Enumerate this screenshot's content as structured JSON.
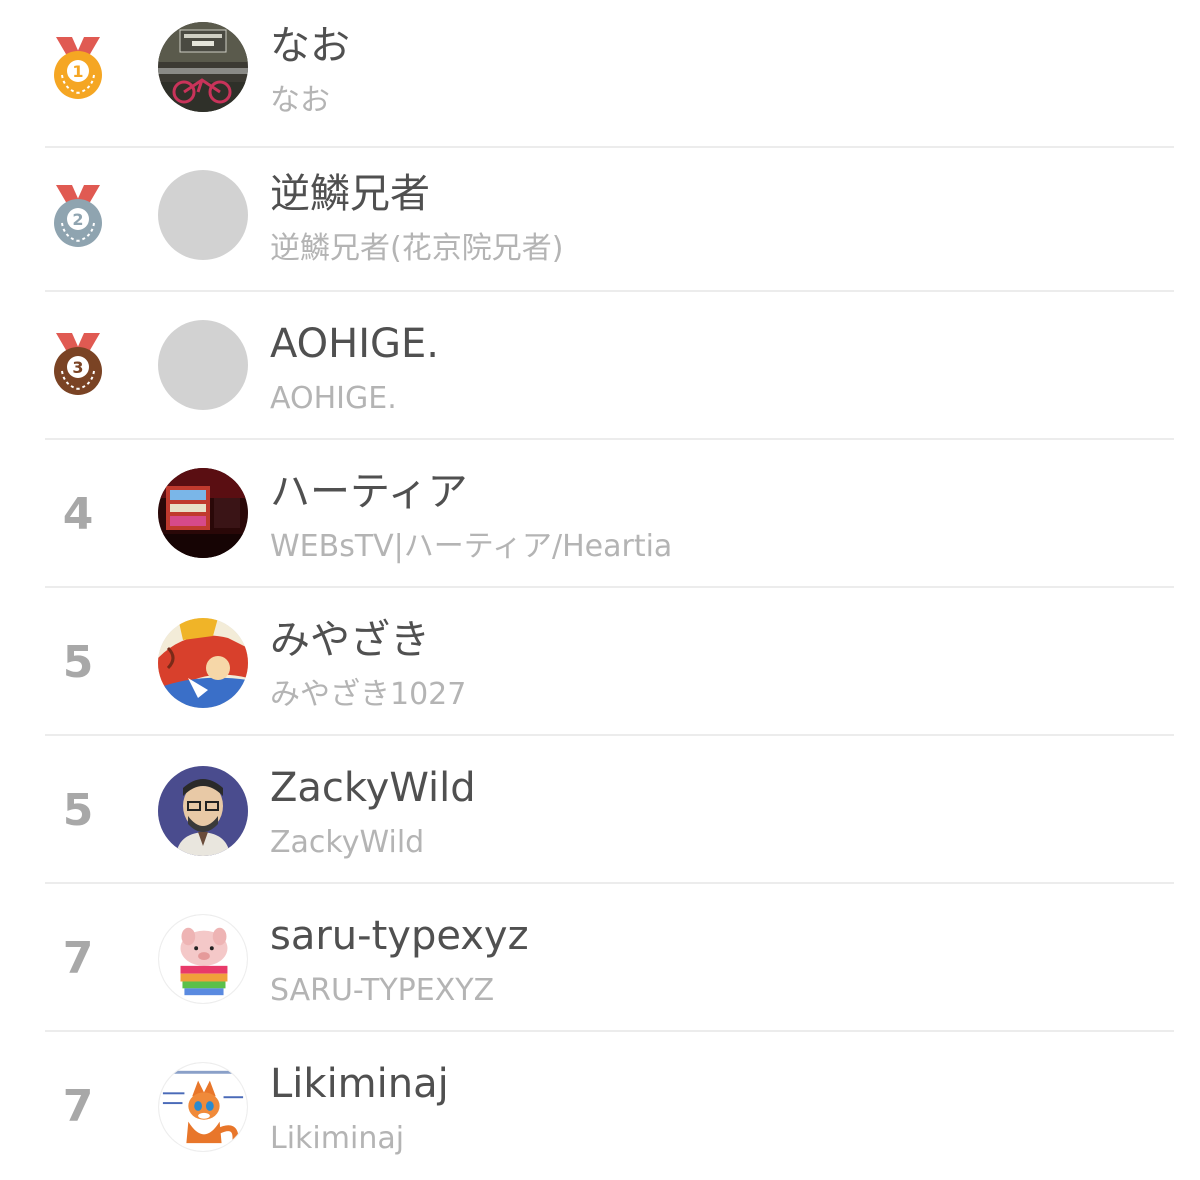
{
  "ranking": [
    {
      "rank": "1",
      "medal": "gold-medal-icon",
      "display_name": "なお",
      "user_name": "なお",
      "avatar": "photo-bicycle"
    },
    {
      "rank": "2",
      "medal": "silver-medal-icon",
      "display_name": "逆鱗兄者",
      "user_name": "逆鱗兄者(花京院兄者)",
      "avatar": "placeholder"
    },
    {
      "rank": "3",
      "medal": "bronze-medal-icon",
      "display_name": "AOHIGE.",
      "user_name": "AOHIGE.",
      "avatar": "placeholder"
    },
    {
      "rank": "4",
      "medal": "",
      "display_name": "ハーティア",
      "user_name": "WEBsTV|ハーティア/Heartia",
      "avatar": "photo-stage-screen"
    },
    {
      "rank": "5",
      "medal": "",
      "display_name": "みやざき",
      "user_name": "みやざき1027",
      "avatar": "illustration-colorful"
    },
    {
      "rank": "5",
      "medal": "",
      "display_name": "ZackyWild",
      "user_name": "ZackyWild",
      "avatar": "illustration-bearded-man"
    },
    {
      "rank": "7",
      "medal": "",
      "display_name": "saru-typexyz",
      "user_name": "SARU-TYPEXYZ",
      "avatar": "photo-piglet-in-cup"
    },
    {
      "rank": "7",
      "medal": "",
      "display_name": "Likiminaj",
      "user_name": "Likiminaj",
      "avatar": "illustration-fox"
    }
  ],
  "colors": {
    "gold": "#f5a623",
    "silver": "#8fa4b0",
    "bronze": "#7a4324",
    "ribbon": "#e05a52",
    "name_text": "#505050",
    "sub_text": "#b4b4b4",
    "rank_text": "#a8a8a8",
    "divider": "#ececec",
    "placeholder_avatar": "#d2d2d2"
  }
}
